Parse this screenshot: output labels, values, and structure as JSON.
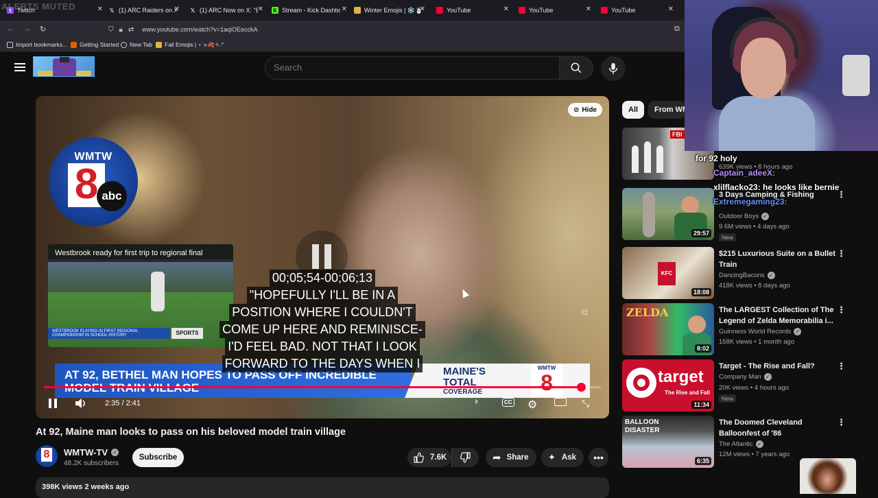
{
  "browser": {
    "alerts_overlay": "ALERTS MUTED",
    "tabs": [
      {
        "label": "Twitch",
        "icon": "twitch-icon"
      },
      {
        "label": "(1) ARC Raiders on X: \"",
        "icon": "x-icon"
      },
      {
        "label": "(1) ARC Now on X: \"Big",
        "icon": "x-icon"
      },
      {
        "label": "Stream - Kick Dashboard",
        "icon": "kick-icon"
      },
      {
        "label": "Winter Emojis | ❄️☃️",
        "icon": "folder-icon"
      },
      {
        "label": "YouTube",
        "icon": "youtube-icon"
      },
      {
        "label": "YouTube",
        "icon": "youtube-icon"
      },
      {
        "label": "YouTube",
        "icon": "youtube-icon"
      }
    ],
    "url": "www.youtube.com/watch?v=1aqiOEecckA",
    "bookmarks": [
      {
        "label": "Import bookmarks..."
      },
      {
        "label": "Getting Started"
      },
      {
        "label": "New Tab"
      },
      {
        "label": "Fall Emojis | ⋆˙⟡🍂✧˖°"
      }
    ]
  },
  "yt": {
    "search_placeholder": "Search"
  },
  "video": {
    "hide_label": "Hide",
    "logo_wmtw": "WMTW",
    "logo_8": "8",
    "logo_abc": "abc",
    "pip_title": "Westbrook ready for first trip to regional final",
    "pip_lower": "WESTBROOK PLAYING IN FIRST REGIONAL CHAMPIONSHIP IN SCHOOL HISTORY",
    "pip_sports": "SPORTS",
    "captions": [
      "00;05;54-00;06;13",
      "\"HOPEFULLY I'LL BE IN A",
      "POSITION WHERE I COULDN'T",
      "COME UP HERE AND REMINISCE-",
      "I'D FEEL BAD. NOT THAT I LOOK",
      "FORWARD TO THE DAYS WHEN I"
    ],
    "lower_third": "AT 92, BETHEL MAN HOPES TO PASS OFF INCREDIBLE MODEL TRAIN VILLAGE",
    "lower_third_maine": "MAINE'S TOTAL",
    "lower_third_coverage": "COVERAGE",
    "lower_third_wmtw": "WMTW",
    "lower_third_8": "8",
    "time": "2:35 / 2:41",
    "progress": 0.964,
    "title": "At 92, Maine man looks to pass on his beloved model train village",
    "channel": "WMTW-TV",
    "subscribers": "48.2K subscribers",
    "subscribe_label": "Subscribe",
    "likes": "7.6K",
    "share_label": "Share",
    "ask_label": "Ask",
    "views_date": "398K views  2 weeks ago"
  },
  "sidebar": {
    "chips": [
      {
        "label": "All",
        "active": true
      },
      {
        "label": "From WM",
        "active": false
      }
    ],
    "recs": [
      {
        "title": "",
        "channel": "",
        "meta": "639K views • 8 hours ago",
        "duration": "",
        "new": false
      },
      {
        "title": "3 Days Camping & Fishing",
        "channel": "Outdoor Boys",
        "meta": "9.6M views • 4 days ago",
        "duration": "29:57",
        "new": true
      },
      {
        "title": "$215 Luxurious Suite on a Bullet Train",
        "channel": "DancingBacons",
        "meta": "418K views • 8 days ago",
        "duration": "18:08",
        "new": false
      },
      {
        "title": "The LARGEST Collection of The Legend of Zelda Memorabilia i...",
        "channel": "Guinness World Records",
        "meta": "158K views • 1 month ago",
        "duration": "8:02",
        "new": false
      },
      {
        "title": "Target - The Rise and Fall?",
        "channel": "Company Man",
        "meta": "20K views • 4 hours ago",
        "duration": "11:34",
        "new": true
      },
      {
        "title": "The Doomed Cleveland Balloonfest of '86",
        "channel": "The Atlantic",
        "meta": "12M views • 7 years ago",
        "duration": "6:35",
        "new": false
      }
    ],
    "new_label": "New",
    "thumb_texts": {
      "fbi": "FBI",
      "kfc": "KFC",
      "zelda": "ZELDA",
      "target": "target",
      "target_sub": "The Rise and Fall",
      "balloon": "BALLOON DISASTER"
    }
  },
  "overlay_chat": [
    {
      "text": "for 92 holy"
    },
    {
      "text": "Captain_adeeX:"
    },
    {
      "text": "xlilflacko23: he looks like bernie"
    },
    {
      "text": "Extremegaming23:"
    }
  ]
}
